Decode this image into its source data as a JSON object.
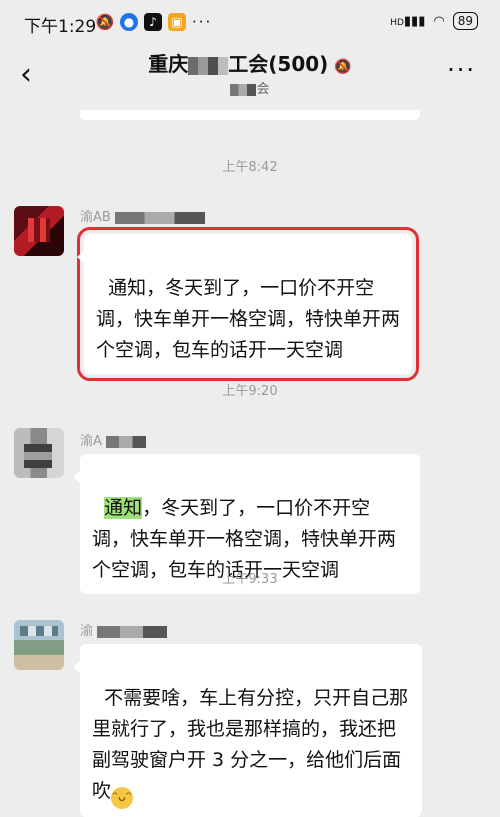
{
  "status_bar": {
    "time": "下午1:29",
    "battery": "89",
    "signal_label": "HD",
    "more_label": "···"
  },
  "title_bar": {
    "title_prefix": "重庆",
    "title_suffix": "工会(500)",
    "subtitle_suffix": "会",
    "more_label": "···",
    "back_label": "‹"
  },
  "timestamps": [
    "上午8:42",
    "上午9:20",
    "上午9:33"
  ],
  "messages": [
    {
      "sender": "渝AB",
      "text": "通知，冬天到了，一口价不开空调，快车单开一格空调，特快单开两个空调，包车的话开一天空调"
    },
    {
      "sender": "渝A",
      "highlight_word": "通知",
      "text_rest": "，冬天到了，一口价不开空调，快车单开一格空调，特快单开两个空调，包车的话开一天空调"
    },
    {
      "sender": "渝",
      "text": "不需要啥，车上有分控，只开自己那里就行了，我也是那样搞的，我还把副驾驶窗户开 3 分之一，给他们后面吹"
    }
  ],
  "colors": {
    "background": "#ededed",
    "bubble": "#ffffff",
    "highlight_box": "#e03034",
    "mark": "#9ee07a"
  },
  "icons": [
    "back-icon",
    "mute-bell-icon",
    "more-icon",
    "wifi-icon",
    "battery-icon",
    "grin-emoji-icon"
  ]
}
